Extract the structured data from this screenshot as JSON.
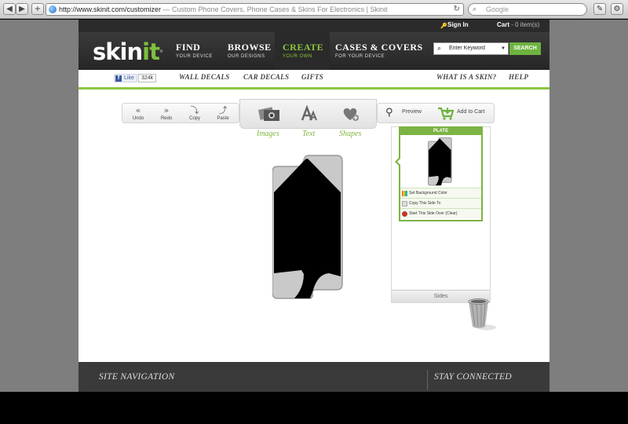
{
  "browser": {
    "back": "◀",
    "forward": "▶",
    "add_tab": "+",
    "url": "http://www.skinit.com/customizer",
    "page_title": " — Custom Phone Covers, Phone Cases & Skins For Electronics | Skinit",
    "reload": "↻",
    "search_placeholder": "Google",
    "search_icon": "⌕"
  },
  "header": {
    "sign_in": "Sign In",
    "cart_label": "Cart",
    "cart_count": " - 0 item(s)",
    "logo_main": "skin",
    "logo_accent": "it",
    "logo_tm": "®"
  },
  "nav": {
    "items": [
      {
        "big": "FIND",
        "small": "YOUR DEVICE"
      },
      {
        "big": "BROWSE",
        "small": "OUR DESIGNS"
      },
      {
        "big": "CREATE",
        "small": "YOUR OWN"
      },
      {
        "big": "CASES & COVERS",
        "small": "FOR YOUR DEVICE"
      }
    ],
    "search_placeholder": "Enter Keyword",
    "search_button": "SEARCH"
  },
  "subnav": {
    "fb_like": "Like",
    "fb_count": "324k",
    "links": [
      "WALL DECALS",
      "CAR DECALS",
      "GIFTS"
    ],
    "right_links": [
      "WHAT IS A SKIN?",
      "HELP"
    ]
  },
  "tools": {
    "undo": "Undo",
    "redo": "Redo",
    "copy": "Copy",
    "paste": "Paste",
    "images": "Images",
    "text": "Text",
    "shapes": "Shapes",
    "preview": "Preview",
    "add_to_cart": "Add to Cart"
  },
  "panel": {
    "plate_title": "PLATE",
    "options": [
      "Set Background Color",
      "Copy This Side To",
      "Start This Side Over (Clear)"
    ],
    "sides_label": "Sides"
  },
  "footer": {
    "site_navigation": "SITE NAVIGATION",
    "stay_connected": "STAY CONNECTED"
  },
  "colors": {
    "brand_green": "#8cc63f",
    "header_dark": "#2b2b2b",
    "footer_dark": "#3a3a3a"
  }
}
